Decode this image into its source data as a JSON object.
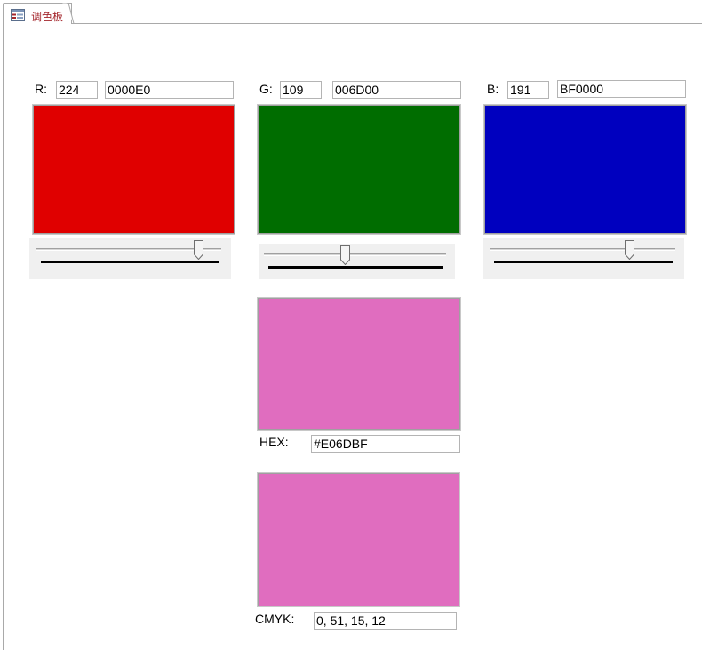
{
  "tab": {
    "label": "调色板",
    "icon": "form-icon"
  },
  "red": {
    "label": "R:",
    "value": "224",
    "hex": "0000E0",
    "color": "#e00000",
    "level": 224
  },
  "green": {
    "label": "G:",
    "value": "109",
    "hex": "006D00",
    "color": "#006d00",
    "level": 109
  },
  "blue": {
    "label": "B:",
    "value": "191",
    "hex": "BF0000",
    "color": "#0000bf",
    "level": 191
  },
  "mix": {
    "color": "#e06dbf",
    "hex_label": "HEX:",
    "hex_value": "#E06DBF",
    "cmyk_label": "CMYK:",
    "cmyk_value": "0, 51, 15, 12"
  }
}
